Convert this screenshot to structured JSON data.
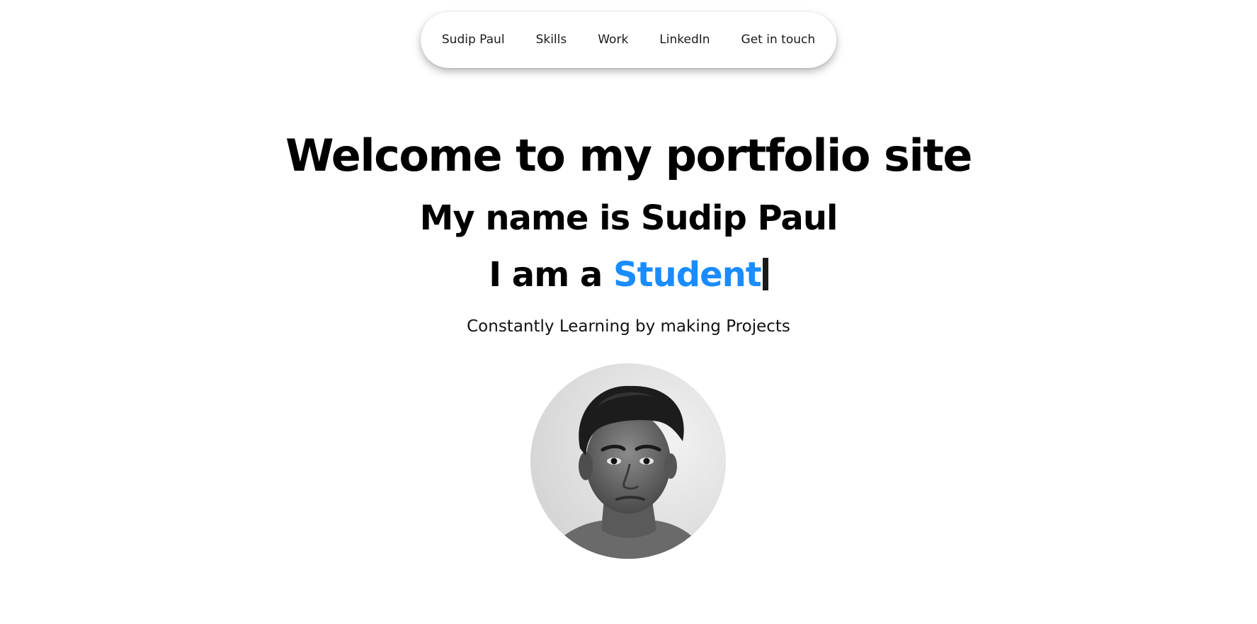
{
  "nav": {
    "items": [
      {
        "label": "Sudip Paul"
      },
      {
        "label": "Skills"
      },
      {
        "label": "Work"
      },
      {
        "label": "LinkedIn"
      },
      {
        "label": "Get in touch"
      }
    ]
  },
  "hero": {
    "welcome": "Welcome to my portfolio site",
    "name_line": "My name is Sudip Paul",
    "role_prefix": "I am a ",
    "role_word": "Student",
    "tagline": "Constantly Learning by making Projects"
  },
  "colors": {
    "accent": "#1a8cff",
    "text": "#000000",
    "background": "#ffffff"
  },
  "icons": {
    "cursor": "text-cursor-icon"
  }
}
